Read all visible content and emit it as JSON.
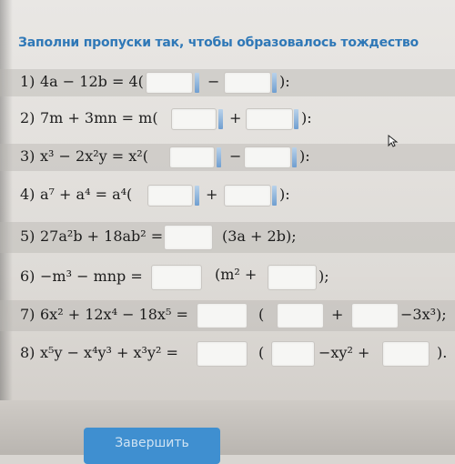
{
  "title": "Заполни пропуски так, чтобы образовалось тождество",
  "items": [
    {
      "num": "1)",
      "expr": "4a − 12b = 4(",
      "sep": "−",
      "end": "):"
    },
    {
      "num": "2)",
      "expr": "7m + 3mn = m(",
      "sep": "+",
      "end": "):"
    },
    {
      "num": "3)",
      "expr": "x³ − 2x²y = x²(",
      "sep": "−",
      "end": "):"
    },
    {
      "num": "4)",
      "expr": "a⁷ + a⁴ = a⁴(",
      "sep": "+",
      "end": "):"
    },
    {
      "num": "5)",
      "expr": "27a²b + 18ab² =",
      "after": "(3a + 2b);"
    },
    {
      "num": "6)",
      "expr": "−m³ − mnp =",
      "after": "(m² +",
      "end": ");"
    },
    {
      "num": "7)",
      "expr": "6x² + 12x⁴ − 18x⁵ =",
      "open": "(",
      "sep": "+",
      "after": "−3x³);"
    },
    {
      "num": "8)",
      "expr": "x⁵y − x⁴y³ + x³y² =",
      "open": "(",
      "mid": "−xy² +",
      "end": ")."
    }
  ],
  "finish_label": "Завершить",
  "accent_color": "#2f78b7",
  "cursor_icon": "mouse-pointer"
}
